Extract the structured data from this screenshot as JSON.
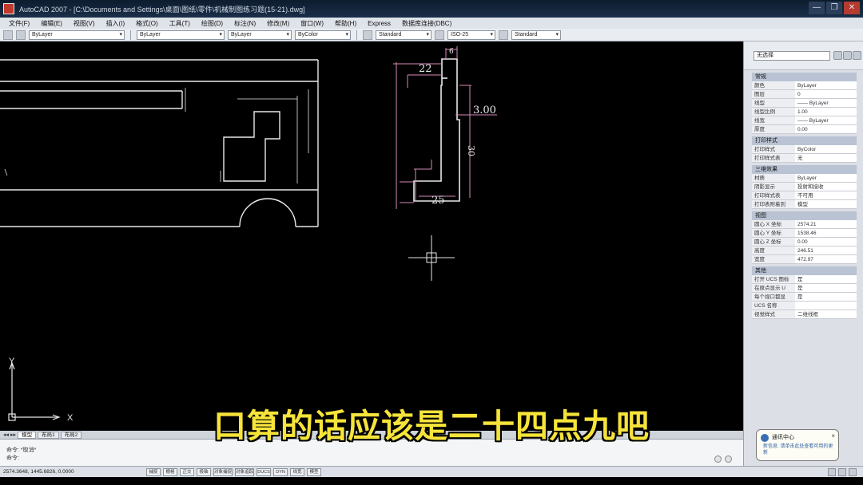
{
  "window": {
    "title": "AutoCAD 2007 - [C:\\Documents and Settings\\桌面\\图纸\\零件\\机械制图练习题(15-21).dwg]",
    "buttons": [
      "—",
      "❐",
      "✕"
    ]
  },
  "menu": [
    "文件(F)",
    "编辑(E)",
    "视图(V)",
    "插入(I)",
    "格式(O)",
    "工具(T)",
    "绘图(D)",
    "标注(N)",
    "修改(M)",
    "窗口(W)",
    "帮助(H)",
    "Express",
    "数据库连接(DBC)"
  ],
  "toolbar": {
    "layer": "ByLayer",
    "linetype_1": "ByLayer",
    "linetype_2": "ByLayer",
    "lineweight": "ByColor",
    "text_style": "Standard",
    "dim_style": "ISO-25",
    "table_style": "Standard"
  },
  "drawing": {
    "dimensions": [
      "22",
      "3.00",
      "25",
      "30",
      "6"
    ],
    "colors": {
      "lines": "#e8e8e8",
      "dims": "#d98ab8",
      "green": "#3fbf3f"
    }
  },
  "ucs": {
    "x_label": "X",
    "y_label": "Y"
  },
  "properties": {
    "selector": "无选择",
    "sections": [
      {
        "title": "常规",
        "rows": [
          {
            "key": "颜色",
            "value": "ByLayer"
          },
          {
            "key": "图层",
            "value": "0"
          },
          {
            "key": "线型",
            "value": "—— ByLayer"
          },
          {
            "key": "线型比例",
            "value": "1.00"
          },
          {
            "key": "线宽",
            "value": "—— ByLayer"
          },
          {
            "key": "厚度",
            "value": "0.00"
          }
        ]
      },
      {
        "title": "打印样式",
        "rows": [
          {
            "key": "打印样式",
            "value": "ByColor"
          },
          {
            "key": "打印样式表",
            "value": "无"
          }
        ]
      },
      {
        "title": "三维效果",
        "rows": [
          {
            "key": "材质",
            "value": "ByLayer"
          },
          {
            "key": "阴影显示",
            "value": "投射和接收"
          },
          {
            "key": "打印样式表",
            "value": "不可用"
          },
          {
            "key": "打印表附着到",
            "value": "模型"
          }
        ]
      },
      {
        "title": "视图",
        "rows": [
          {
            "key": "圆心 X 坐标",
            "value": "2574.21"
          },
          {
            "key": "圆心 Y 坐标",
            "value": "1538.46"
          },
          {
            "key": "圆心 Z 坐标",
            "value": "0.00"
          },
          {
            "key": "高度",
            "value": "246.51"
          },
          {
            "key": "宽度",
            "value": "472.97"
          }
        ]
      },
      {
        "title": "其他",
        "rows": [
          {
            "key": "打开 UCS 图标",
            "value": "是"
          },
          {
            "key": "在原点显示 U",
            "value": "是"
          },
          {
            "key": "每个视口都显",
            "value": "是"
          },
          {
            "key": "UCS 名称",
            "value": ""
          },
          {
            "key": "视觉样式",
            "value": "二维线框"
          }
        ]
      }
    ]
  },
  "notification": {
    "title": "通讯中心",
    "body": "新信息: 请单击此处查看可用的更新"
  },
  "tabs": [
    "模型",
    "布局1",
    "布局2"
  ],
  "command": {
    "line1": "命令: *取消*",
    "line2": "命令:"
  },
  "status": {
    "coords": "2574.3648, 1445.6826, 0.0000",
    "toggles": [
      "捕捉",
      "栅格",
      "正交",
      "极轴",
      "对象捕捉",
      "对象追踪",
      "DUCS",
      "DYN",
      "线宽",
      "模型"
    ]
  },
  "subtitle": "口算的话应该是二十四点九吧"
}
